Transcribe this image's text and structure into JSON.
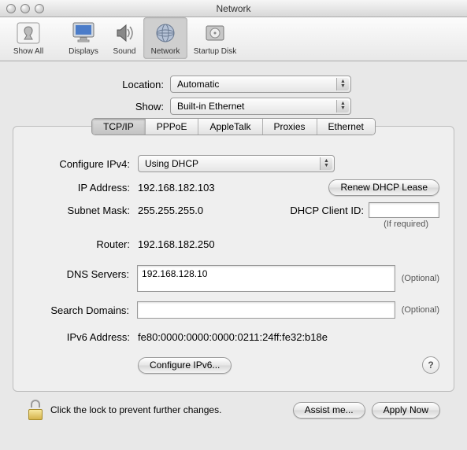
{
  "window": {
    "title": "Network"
  },
  "toolbar": {
    "show_all": "Show All",
    "displays": "Displays",
    "sound": "Sound",
    "network": "Network",
    "startup": "Startup Disk"
  },
  "top_form": {
    "location_label": "Location:",
    "location_value": "Automatic",
    "show_label": "Show:",
    "show_value": "Built-in Ethernet"
  },
  "tabs": {
    "tcpip": "TCP/IP",
    "pppoe": "PPPoE",
    "appletalk": "AppleTalk",
    "proxies": "Proxies",
    "ethernet": "Ethernet"
  },
  "tcpip": {
    "configure_label": "Configure IPv4:",
    "configure_value": "Using DHCP",
    "ip_label": "IP Address:",
    "ip_value": "192.168.182.103",
    "renew_label": "Renew DHCP Lease",
    "subnet_label": "Subnet Mask:",
    "subnet_value": "255.255.255.0",
    "dhcp_client_label": "DHCP Client ID:",
    "dhcp_client_value": "",
    "dhcp_hint": "(If required)",
    "router_label": "Router:",
    "router_value": "192.168.182.250",
    "dns_label": "DNS Servers:",
    "dns_value": "192.168.128.10",
    "search_label": "Search Domains:",
    "search_value": "",
    "optional_text": "(Optional)",
    "ipv6addr_label": "IPv6 Address:",
    "ipv6addr_value": "fe80:0000:0000:0000:0211:24ff:fe32:b18e",
    "configure_ipv6_label": "Configure IPv6...",
    "help_label": "?"
  },
  "footer": {
    "lock_text": "Click the lock to prevent further changes.",
    "assist": "Assist me...",
    "apply": "Apply Now"
  }
}
